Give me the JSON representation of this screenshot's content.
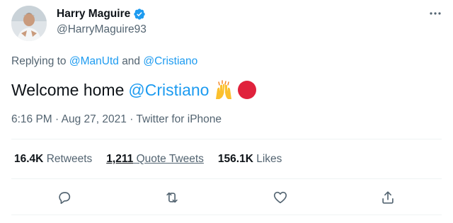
{
  "user": {
    "display_name": "Harry Maguire",
    "handle": "@HarryMaguire93",
    "verified": true
  },
  "reply": {
    "prefix": "Replying to",
    "mention_1": "@ManUtd",
    "conjunction": "and",
    "mention_2": "@Cristiano"
  },
  "tweet": {
    "text": "Welcome home",
    "mention": "@Cristiano",
    "emojis": [
      "raising-hands",
      "red-circle"
    ]
  },
  "meta": {
    "time": "6:16 PM",
    "separator": "·",
    "date": "Aug 27, 2021",
    "source": "Twitter for iPhone"
  },
  "stats": {
    "retweets_count": "16.4K",
    "retweets_label": "Retweets",
    "quotes_count": "1,211",
    "quotes_label": "Quote Tweets",
    "likes_count": "156.1K",
    "likes_label": "Likes"
  },
  "colors": {
    "accent": "#1d9bf0",
    "secondary_text": "#536471",
    "red_circle": "#e0223c"
  },
  "icons": [
    "reply-icon",
    "retweet-icon",
    "like-icon",
    "share-icon",
    "more-icon",
    "verified-icon"
  ]
}
